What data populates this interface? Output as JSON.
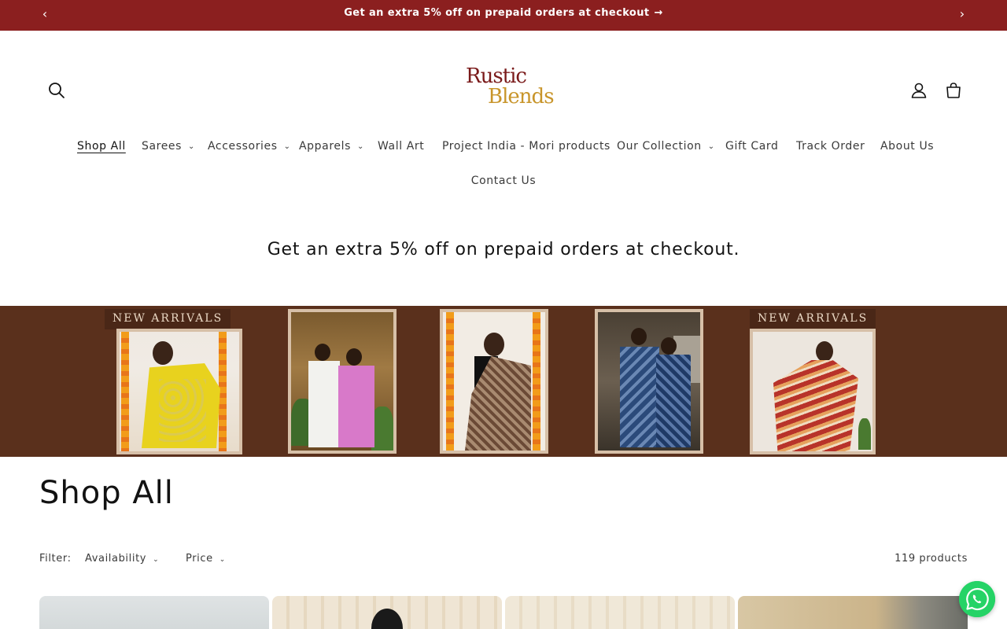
{
  "announcement": {
    "text": "Get an extra 5% off on prepaid orders at checkout",
    "arrow": "→",
    "prev_icon": "‹",
    "next_icon": "›"
  },
  "header": {
    "logo_line1": "Rustic",
    "logo_line2": "Blends",
    "icons": [
      "search-icon",
      "account-icon",
      "cart-icon"
    ]
  },
  "nav": {
    "items": [
      {
        "label": "Shop All",
        "has_dropdown": false,
        "active": true
      },
      {
        "label": "Sarees",
        "has_dropdown": true
      },
      {
        "label": "Accessories",
        "has_dropdown": true
      },
      {
        "label": "Apparels",
        "has_dropdown": true
      },
      {
        "label": "Wall Art",
        "has_dropdown": false
      },
      {
        "label": "Project India - Mori products",
        "has_dropdown": false
      },
      {
        "label": "Our Collection",
        "has_dropdown": true
      },
      {
        "label": "Gift Card",
        "has_dropdown": false
      },
      {
        "label": "Track Order",
        "has_dropdown": false
      },
      {
        "label": "About Us",
        "has_dropdown": false
      },
      {
        "label": "Contact Us",
        "has_dropdown": false
      }
    ],
    "chevron": "⌄"
  },
  "promo": {
    "text": "Get an extra 5% off on prepaid orders at checkout."
  },
  "banner": {
    "tag_left": "NEW ARRIVALS",
    "tag_right": "NEW ARRIVALS",
    "background": "#5a301c"
  },
  "collection": {
    "title": "Shop All",
    "filter_label": "Filter:",
    "filters": [
      "Availability",
      "Price"
    ],
    "count": "119 products"
  },
  "colors": {
    "announcement_bg": "#8b1f1f",
    "logo_primary": "#7a1a1a",
    "logo_accent": "#c8952b",
    "whatsapp": "#25d366"
  }
}
